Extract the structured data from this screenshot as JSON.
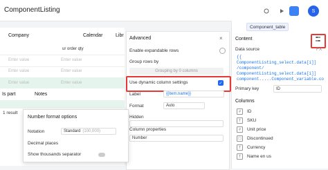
{
  "app": {
    "title": "ComponentListing"
  },
  "table": {
    "columns": [
      "Company",
      "Calendar",
      "Libr"
    ],
    "placeholder": "Enter value",
    "partial": "ur order qty",
    "is_part": "Is part",
    "notes": "Notes",
    "result": "1 result"
  },
  "advanced": {
    "title": "Advanced",
    "expandable": "Enable expandable rows",
    "group_rows": "Group rows by",
    "grouping_chip": "Grouping by 0 columns",
    "dynamic": "Use dynamic column settings",
    "label_label": "Label",
    "label_value": "{{item.name}}",
    "format_label": "Format",
    "format_value": "Auto",
    "hidden_label": "Hidden",
    "col_props": "Column properties",
    "col_props_value": "Number"
  },
  "popup": {
    "title": "Number format options",
    "notation": "Notation",
    "notation_value": "Standard",
    "notation_hint": "(100,000)",
    "decimal": "Decimal places",
    "thousands": "Show thousands separator"
  },
  "right": {
    "tab": "Component_table",
    "content": "Content",
    "data_source": "Data source",
    "fx": "FX",
    "code": [
      "{{",
      "ComponentListing_select.data[i]]",
      "/component/",
      "ComponentListing_select.data[i]]",
      "component.....Component_variable.co"
    ],
    "primary_key": "Primary key",
    "pk_value": "ID",
    "columns_title": "Columns",
    "columns": [
      "ID",
      "SKU",
      "Unit price",
      "Discontinued",
      "Currency",
      "Name en us"
    ]
  }
}
